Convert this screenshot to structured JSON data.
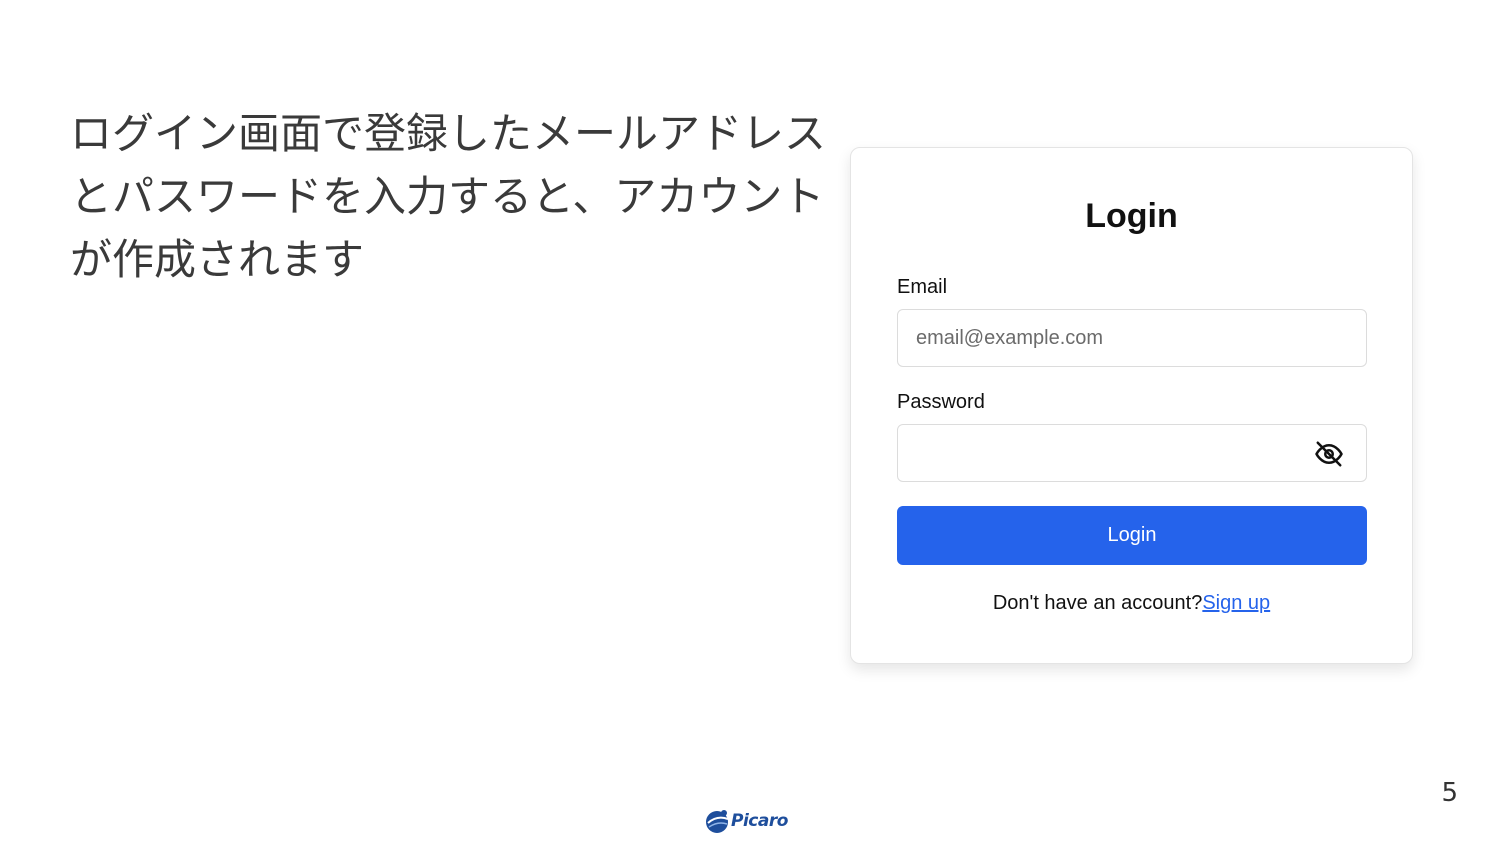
{
  "slide": {
    "description": "ログイン画面で登録したメールアドレスとパスワードを入力すると、アカウントが作成されます",
    "page_number": "5"
  },
  "login_form": {
    "title": "Login",
    "email_label": "Email",
    "email_placeholder": "email@example.com",
    "email_value": "",
    "password_label": "Password",
    "password_value": "",
    "password_visibility_icon": "eye-off-icon",
    "login_button_label": "Login",
    "signup_prompt": "Don't have an account?",
    "signup_link_label": "Sign up"
  },
  "footer": {
    "logo_text": "Picaro"
  },
  "colors": {
    "primary": "#2563eb",
    "logo": "#1e4e9c",
    "text": "#111111"
  }
}
